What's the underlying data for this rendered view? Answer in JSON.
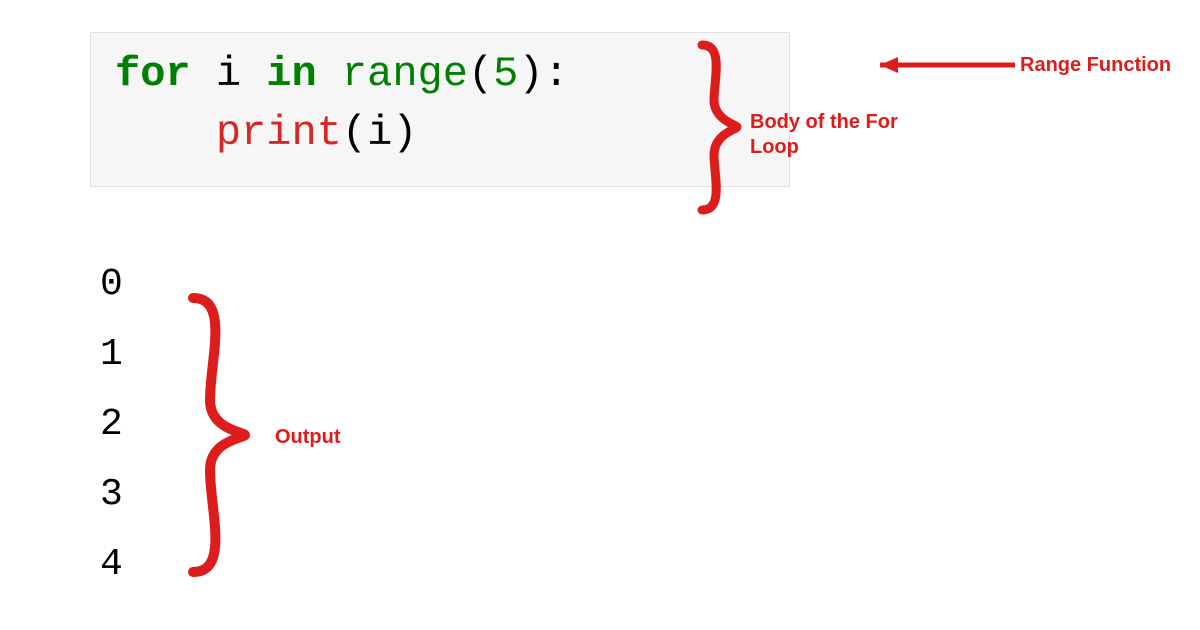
{
  "code": {
    "for": "for",
    "var": "i",
    "in": "in",
    "range": "range",
    "lpar1": "(",
    "arg": "5",
    "rpar1": ")",
    "colon": ":",
    "indent": "    ",
    "print": "print",
    "lpar2": "(",
    "printArg": "i",
    "rpar2": ")"
  },
  "output": [
    "0",
    "1",
    "2",
    "3",
    "4"
  ],
  "labels": {
    "rangeFunction": "Range Function",
    "bodyLoop": "Body of the For Loop",
    "output": "Output"
  }
}
